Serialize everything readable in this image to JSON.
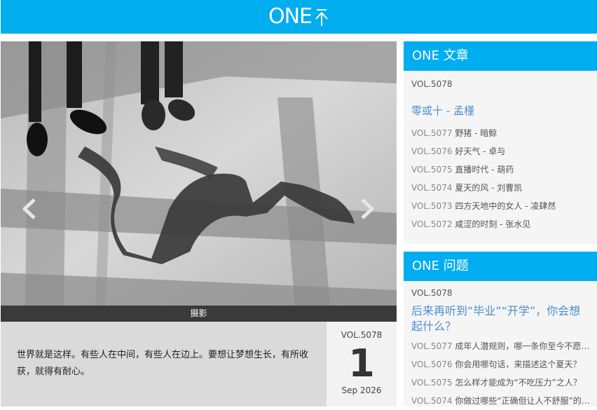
{
  "header": {
    "logo_text": "ONE",
    "logo_mark": "logo-mark-icon",
    "color": "#00adef"
  },
  "photo": {
    "caption": "摄影",
    "prev_icon": "chevron-left-icon",
    "next_icon": "chevron-right-icon"
  },
  "quote": {
    "text": "世界就是这样。有些人在中间，有些人在边上。要想让梦想生长，有所收获，就得有耐心。"
  },
  "date": {
    "vol": "VOL.5078",
    "day": "1",
    "month_year": "Sep 2026"
  },
  "articles": {
    "heading": "ONE 文章",
    "vol": "VOL.5078",
    "featured": "零或十 - 孟槿",
    "items": [
      {
        "vol": "VOL.5077",
        "title": "野猪 - 暗鲸"
      },
      {
        "vol": "VOL.5076",
        "title": "好天气 - 卓与"
      },
      {
        "vol": "VOL.5075",
        "title": "直播时代 - 葫药"
      },
      {
        "vol": "VOL.5074",
        "title": "夏天的风 - 刘曹凯"
      },
      {
        "vol": "VOL.5073",
        "title": "四方天地中的女人 - 凌肆然"
      },
      {
        "vol": "VOL.5072",
        "title": "咸涩的时刻 - 张水见"
      }
    ]
  },
  "questions": {
    "heading": "ONE 问题",
    "vol": "VOL.5078",
    "featured": "后来再听到“毕业”“开学”，你会想起什么？",
    "items": [
      {
        "vol": "VOL.5077",
        "title": "成年人潜规则，哪一条你至今不愿接受？"
      },
      {
        "vol": "VOL.5076",
        "title": "你会用哪句话，来描述这个夏天？"
      },
      {
        "vol": "VOL.5075",
        "title": "怎么样才能成为“不吃压力”之人？"
      },
      {
        "vol": "VOL.5074",
        "title": "你做过哪些“正确但让人不舒服”的选择？"
      }
    ]
  }
}
